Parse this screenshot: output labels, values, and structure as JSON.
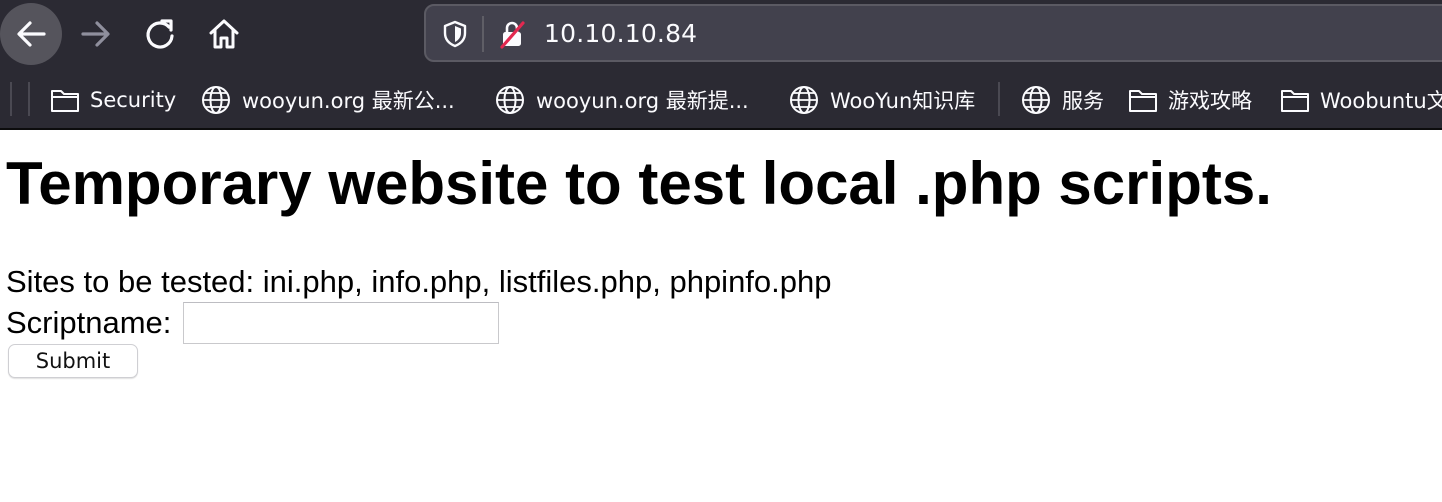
{
  "browser": {
    "url": "10.10.10.84",
    "bookmarks": [
      {
        "icon": "folder-icon",
        "label": "Security"
      },
      {
        "icon": "globe-icon",
        "label": "wooyun.org 最新公..."
      },
      {
        "icon": "globe-icon",
        "label": "wooyun.org 最新提..."
      },
      {
        "icon": "globe-icon",
        "label": "WooYun知识库"
      },
      {
        "icon": "globe-icon",
        "label": "服务"
      },
      {
        "icon": "folder-icon",
        "label": "游戏攻略"
      },
      {
        "icon": "folder-icon",
        "label": "Woobuntu文"
      }
    ],
    "colors": {
      "toolbar_bg": "#2b2a33",
      "urlbar_bg": "#42414d",
      "text": "#fbfbfe",
      "insecure_slash": "#e22850"
    }
  },
  "page": {
    "title": "Temporary website to test local .php scripts.",
    "sites_text": "Sites to be tested: ini.php, info.php, listfiles.php, phpinfo.php",
    "form": {
      "label": "Scriptname:",
      "input_value": "",
      "submit_label": "Submit"
    }
  }
}
